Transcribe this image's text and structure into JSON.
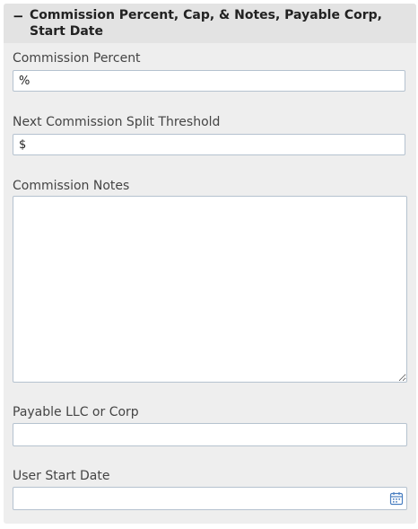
{
  "panel": {
    "toggle_symbol": "−",
    "title": "Commission Percent, Cap, & Notes, Payable Corp, Start Date"
  },
  "fields": {
    "commission_percent": {
      "label": "Commission Percent",
      "value": "%"
    },
    "split_threshold": {
      "label": "Next Commission Split Threshold",
      "value": "$"
    },
    "commission_notes": {
      "label": "Commission Notes",
      "value": ""
    },
    "payable_corp": {
      "label": "Payable LLC or Corp",
      "value": ""
    },
    "start_date": {
      "label": "User Start Date",
      "value": "",
      "icon": "calendar-icon"
    }
  },
  "colors": {
    "panel_background": "#eeeeee",
    "header_background": "#e3e3e3",
    "input_border": "#b5c2cf",
    "icon_color": "#4a7fc1"
  }
}
